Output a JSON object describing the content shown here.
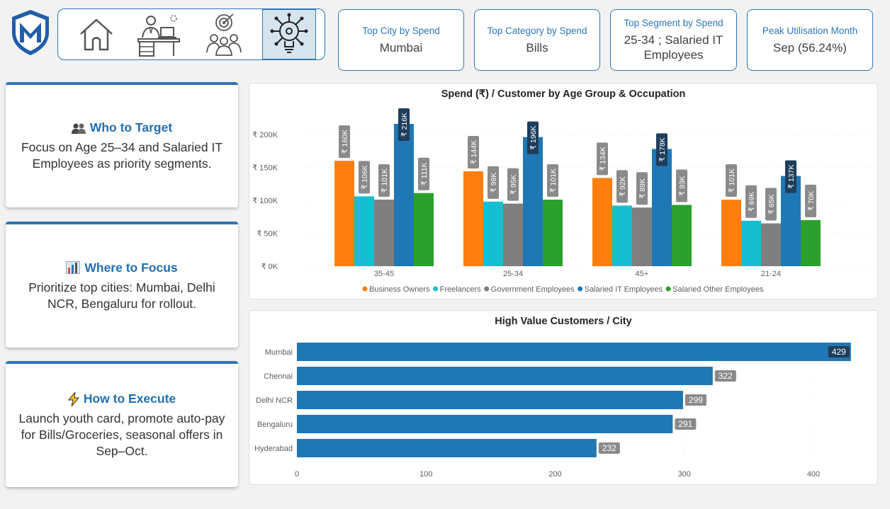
{
  "nav": {
    "items": [
      {
        "icon": "home-icon",
        "active": false
      },
      {
        "icon": "workspace-icon",
        "active": false
      },
      {
        "icon": "target-audience-icon",
        "active": false
      },
      {
        "icon": "lightbulb-icon",
        "active": true
      }
    ]
  },
  "kpis": [
    {
      "title": "Top City by Spend",
      "value": "Mumbai"
    },
    {
      "title": "Top Category by Spend",
      "value": "Bills"
    },
    {
      "title": "Top Segment by Spend",
      "value": "25-34 ; Salaried IT Employees"
    },
    {
      "title": "Peak Utilisation Month",
      "value": "Sep (56.24%)"
    }
  ],
  "insights": [
    {
      "heading": "Who to Target",
      "icon": "people-icon",
      "text": "Focus on Age 25–34 and Salaried IT Employees as priority segments."
    },
    {
      "heading": "Where to Focus",
      "icon": "city-chart-icon",
      "text": "Prioritize top cities: Mumbai, Delhi NCR, Bengaluru for rollout."
    },
    {
      "heading": "How to Execute",
      "icon": "lightning-icon",
      "text": "Launch youth card, promote auto-pay for Bills/Groceries, seasonal offers in Sep–Oct."
    }
  ],
  "chart_data": [
    {
      "type": "bar",
      "title": "Spend (₹) / Customer by Age Group & Occupation",
      "categories": [
        "35-45",
        "25-34",
        "45+",
        "21-24"
      ],
      "ylim": [
        0,
        230
      ],
      "yticks": [
        0,
        50,
        100,
        150,
        200
      ],
      "ytick_labels": [
        "₹ 0K",
        "₹ 50K",
        "₹ 100K",
        "₹ 150K",
        "₹ 200K"
      ],
      "legend_position": "bottom",
      "series": [
        {
          "name": "Business Owners",
          "color": "#ff7f0e",
          "values": [
            160,
            144,
            134,
            101
          ],
          "labels": [
            "₹ 160K",
            "₹ 144K",
            "₹ 134K",
            "₹ 101K"
          ]
        },
        {
          "name": "Freelancers",
          "color": "#17becf",
          "values": [
            106,
            98,
            92,
            69
          ],
          "labels": [
            "₹ 106K",
            "₹ 98K",
            "₹ 92K",
            "₹ 69K"
          ]
        },
        {
          "name": "Government Employees",
          "color": "#7f7f7f",
          "values": [
            101,
            95,
            89,
            65
          ],
          "labels": [
            "₹ 101K",
            "₹ 95K",
            "₹ 89K",
            "₹ 65K"
          ]
        },
        {
          "name": "Salaried IT Employees",
          "color": "#1f77b4",
          "values": [
            216,
            196,
            178,
            137
          ],
          "labels": [
            "₹ 216K",
            "₹ 196K",
            "₹ 178K",
            "₹ 137K"
          ]
        },
        {
          "name": "Salaried Other Employees",
          "color": "#2ca02c",
          "values": [
            111,
            101,
            93,
            70
          ],
          "labels": [
            "₹ 111K",
            "₹ 101K",
            "₹ 93K",
            "₹ 70K"
          ]
        }
      ]
    },
    {
      "type": "bar",
      "orientation": "horizontal",
      "title": "High Value Customers / City",
      "categories": [
        "Mumbai",
        "Chennai",
        "Delhi NCR",
        "Bengaluru",
        "Hyderabad"
      ],
      "values": [
        429,
        322,
        299,
        291,
        232
      ],
      "xlim": [
        0,
        440
      ],
      "xticks": [
        0,
        100,
        200,
        300,
        400
      ],
      "color": "#1f77b4"
    }
  ]
}
